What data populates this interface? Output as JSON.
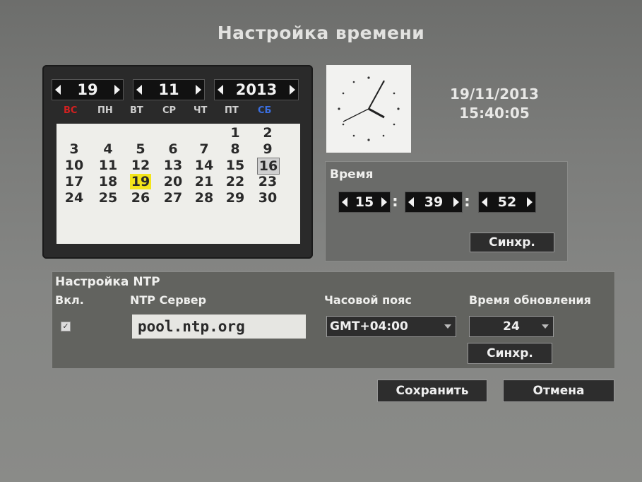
{
  "title": "Настройка времени",
  "calendar": {
    "day": "19",
    "month": "11",
    "year": "2013",
    "weekdays": [
      "ВС",
      "ПН",
      "ВТ",
      "СР",
      "ЧТ",
      "ПТ",
      "СБ"
    ],
    "weekday_colors": {
      "sunday": "#d42020",
      "saturday": "#3a6ee0"
    },
    "selected_day": "19",
    "today": "16",
    "weeks": [
      [
        "",
        "",
        "",
        "",
        "",
        "1",
        "2"
      ],
      [
        "3",
        "4",
        "5",
        "6",
        "7",
        "8",
        "9"
      ],
      [
        "10",
        "11",
        "12",
        "13",
        "14",
        "15",
        "16"
      ],
      [
        "17",
        "18",
        "19",
        "20",
        "21",
        "22",
        "23"
      ],
      [
        "24",
        "25",
        "26",
        "27",
        "28",
        "29",
        "30"
      ]
    ]
  },
  "clock": {
    "date": "19/11/2013",
    "time": "15:40:05"
  },
  "time_panel": {
    "label": "Время",
    "hours": "15",
    "minutes": "39",
    "seconds": "52",
    "sync_label": "Синхр."
  },
  "ntp": {
    "section_title": "Настройка NTP",
    "enable_label": "Вкл.",
    "enabled": true,
    "server_label": "NTP Сервер",
    "server_value": "pool.ntp.org",
    "timezone_label": "Часовой пояс",
    "timezone_value": "GMT+04:00",
    "update_label": "Время обновления",
    "update_value": "24",
    "sync_label": "Синхр."
  },
  "footer": {
    "save_label": "Сохранить",
    "cancel_label": "Отмена"
  },
  "icons": [
    "chevron-left-icon",
    "chevron-right-icon",
    "clock-icon",
    "checkbox-icon",
    "dropdown-caret-icon"
  ]
}
